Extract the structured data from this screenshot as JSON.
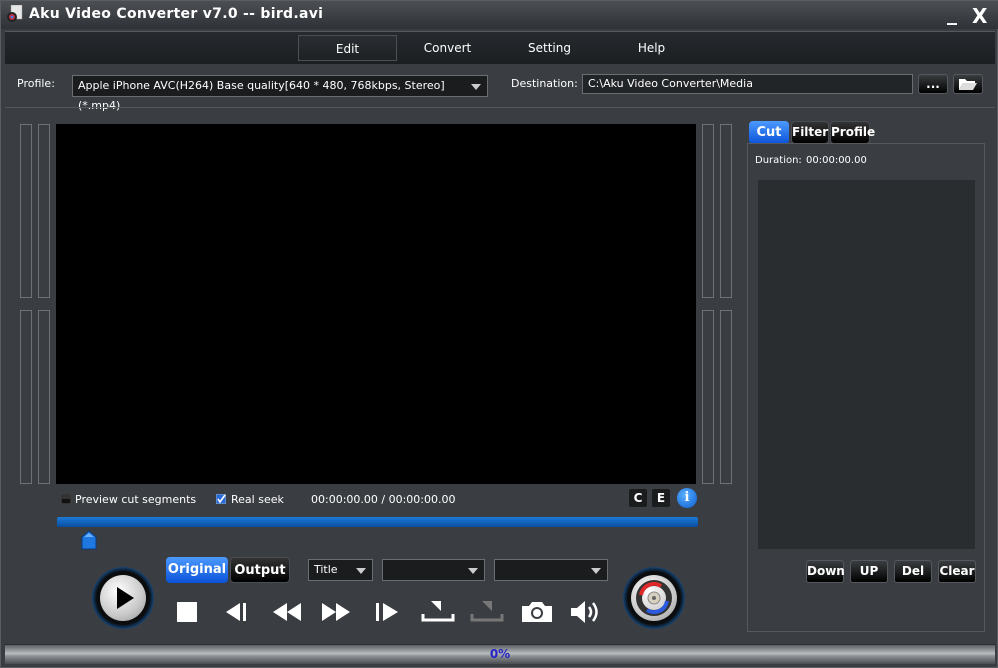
{
  "window": {
    "title": "Aku Video Converter v7.0  --  bird.avi",
    "minimize_label": "_",
    "close_label": "X"
  },
  "menu": {
    "items": [
      {
        "label": "Edit",
        "active": true
      },
      {
        "label": "Convert",
        "active": false
      },
      {
        "label": "Setting",
        "active": false
      },
      {
        "label": "Help",
        "active": false
      }
    ]
  },
  "profile": {
    "label": "Profile:",
    "value": "Apple iPhone AVC(H264) Base quality[640 * 480, 768kbps, Stereo] (*.mp4)"
  },
  "destination": {
    "label": "Destination:",
    "value": "C:\\Aku Video Converter\\Media",
    "browse_label": "...",
    "open_folder_icon": "folder-open-icon"
  },
  "player": {
    "preview_cut_label": "Preview cut segments",
    "preview_cut_checked": false,
    "real_seek_label": "Real seek",
    "real_seek_checked": true,
    "time_display": "00:00:00.00 / 00:00:00.00",
    "c_label": "C",
    "e_label": "E",
    "info_label": "i",
    "seek_position": 0
  },
  "view_toggle": {
    "original_label": "Original",
    "output_label": "Output",
    "active": "Original"
  },
  "selectors": {
    "title_select": "Title",
    "select2": "",
    "select3": ""
  },
  "controls": {
    "icons": [
      "play-icon",
      "stop-icon",
      "previous-frame-icon",
      "rewind-icon",
      "fast-forward-icon",
      "next-frame-icon",
      "set-start-icon",
      "set-end-icon",
      "snapshot-camera-icon",
      "volume-icon",
      "convert-icon"
    ]
  },
  "side_panel": {
    "tabs": [
      {
        "label": "Cut",
        "active": true
      },
      {
        "label": "Filter",
        "active": false
      },
      {
        "label": "Profile",
        "active": false
      }
    ],
    "duration_label": "Duration:",
    "duration_value": "00:00:00.00",
    "buttons": {
      "down": "Down",
      "up": "UP",
      "del": "Del",
      "clear": "Clear"
    }
  },
  "status": {
    "progress_text": "0%",
    "progress": 0
  }
}
